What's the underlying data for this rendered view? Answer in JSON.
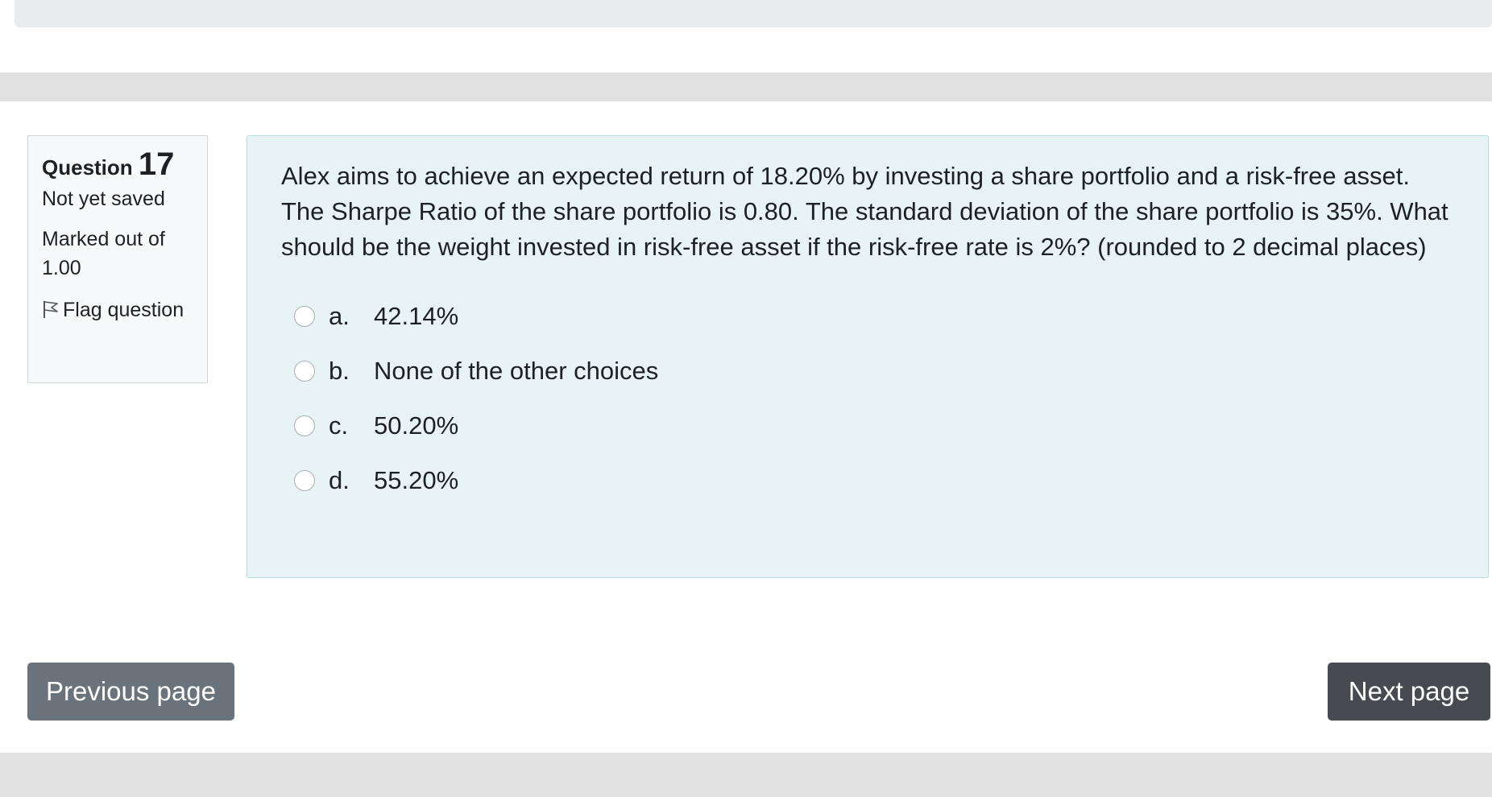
{
  "question_info": {
    "label": "Question",
    "number": "17",
    "state": "Not yet saved",
    "grade": "Marked out of 1.00",
    "flag_label": "Flag question"
  },
  "question": {
    "text": "Alex aims to achieve an expected return of 18.20% by investing a share portfolio and a risk-free asset. The Sharpe Ratio of the share portfolio is 0.80. The standard deviation of the share portfolio is 35%. What should be the weight invested in risk-free asset if the risk-free rate is 2%? (rounded to 2 decimal places)",
    "answers": [
      {
        "letter": "a.",
        "text": "42.14%"
      },
      {
        "letter": "b.",
        "text": "None of the other choices"
      },
      {
        "letter": "c.",
        "text": "50.20%"
      },
      {
        "letter": "d.",
        "text": "55.20%"
      }
    ]
  },
  "navigation": {
    "previous_label": "Previous page",
    "next_label": "Next page"
  },
  "colors": {
    "content_bg": "#e7f3f5",
    "info_bg": "#f8f9fa",
    "prev_button": "#6a737b",
    "next_button": "#474a51"
  }
}
